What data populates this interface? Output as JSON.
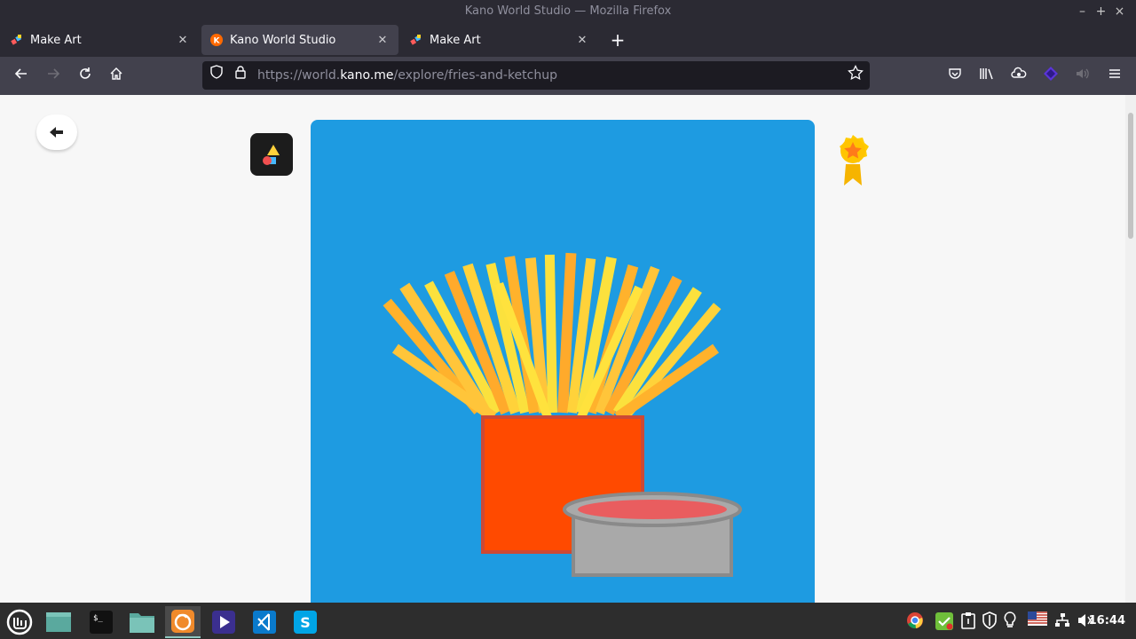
{
  "window": {
    "title": "Kano World Studio — Mozilla Firefox",
    "controls": [
      "–",
      "+",
      "×"
    ]
  },
  "tabs": [
    {
      "label": "Make Art",
      "active": false
    },
    {
      "label": "Kano World Studio",
      "active": true
    },
    {
      "label": "Make Art",
      "active": false
    }
  ],
  "newtab_label": "+",
  "url": {
    "prefix": "https://world.",
    "domain": "kano.me",
    "path": "/explore/fries-and-ketchup"
  },
  "toolbar_icons": [
    "back-icon",
    "forward-icon",
    "reload-icon",
    "home-icon",
    "shield-icon",
    "lock-icon",
    "bookmark-star-icon",
    "pocket-icon",
    "library-icon",
    "extensions-icon",
    "purple-extension-icon",
    "volume-icon",
    "menu-icon"
  ],
  "page": {
    "artwork_name": "fries-and-ketchup",
    "colors": {
      "canvas": "#1e9be1",
      "box": "#ff4a00",
      "box_border": "#cc4935",
      "ketchup": "#e95d5f",
      "cup": "#a9a9a9",
      "cup_border": "#8a8a8a"
    }
  },
  "taskbar": {
    "apps": [
      "mint-menu-icon",
      "desktop-icon",
      "terminal-icon",
      "files-icon",
      "firefox-icon",
      "media-player-icon",
      "vscode-icon",
      "skype-icon"
    ],
    "clock": "16:44"
  }
}
